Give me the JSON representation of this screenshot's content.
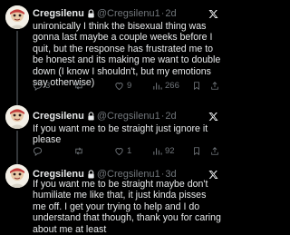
{
  "colors": {
    "background": "#000000",
    "text": "#e7e9ea",
    "secondary": "#71767b",
    "thread_line": "#333639"
  },
  "tweets": [
    {
      "name": "Cregsilenu",
      "handle": "@Cregsilenu1",
      "separator": "·",
      "time": "2d",
      "text": "unironically I think the bisexual thing was gonna last maybe a couple weeks before I quit, but the response has frustrated me to be honest and its making me want to double down (I know I shouldn't, but my emotions say otherwise)",
      "replies": "3",
      "retweets": "",
      "likes": "9",
      "views": "266"
    },
    {
      "name": "Cregsilenu",
      "handle": "@Cregsilenu1",
      "separator": "·",
      "time": "2d",
      "text": "If you want me to be straight just ignore it please",
      "replies": "",
      "retweets": "",
      "likes": "1",
      "views": "92"
    },
    {
      "name": "Cregsilenu",
      "handle": "@Cregsilenu1",
      "separator": "·",
      "time": "3d",
      "text": "If you want me to be straight maybe don't humiliate me like that, it just kinda pisses me off. I get your trying to help and I do understand that though, thank you for caring about me at least"
    }
  ]
}
